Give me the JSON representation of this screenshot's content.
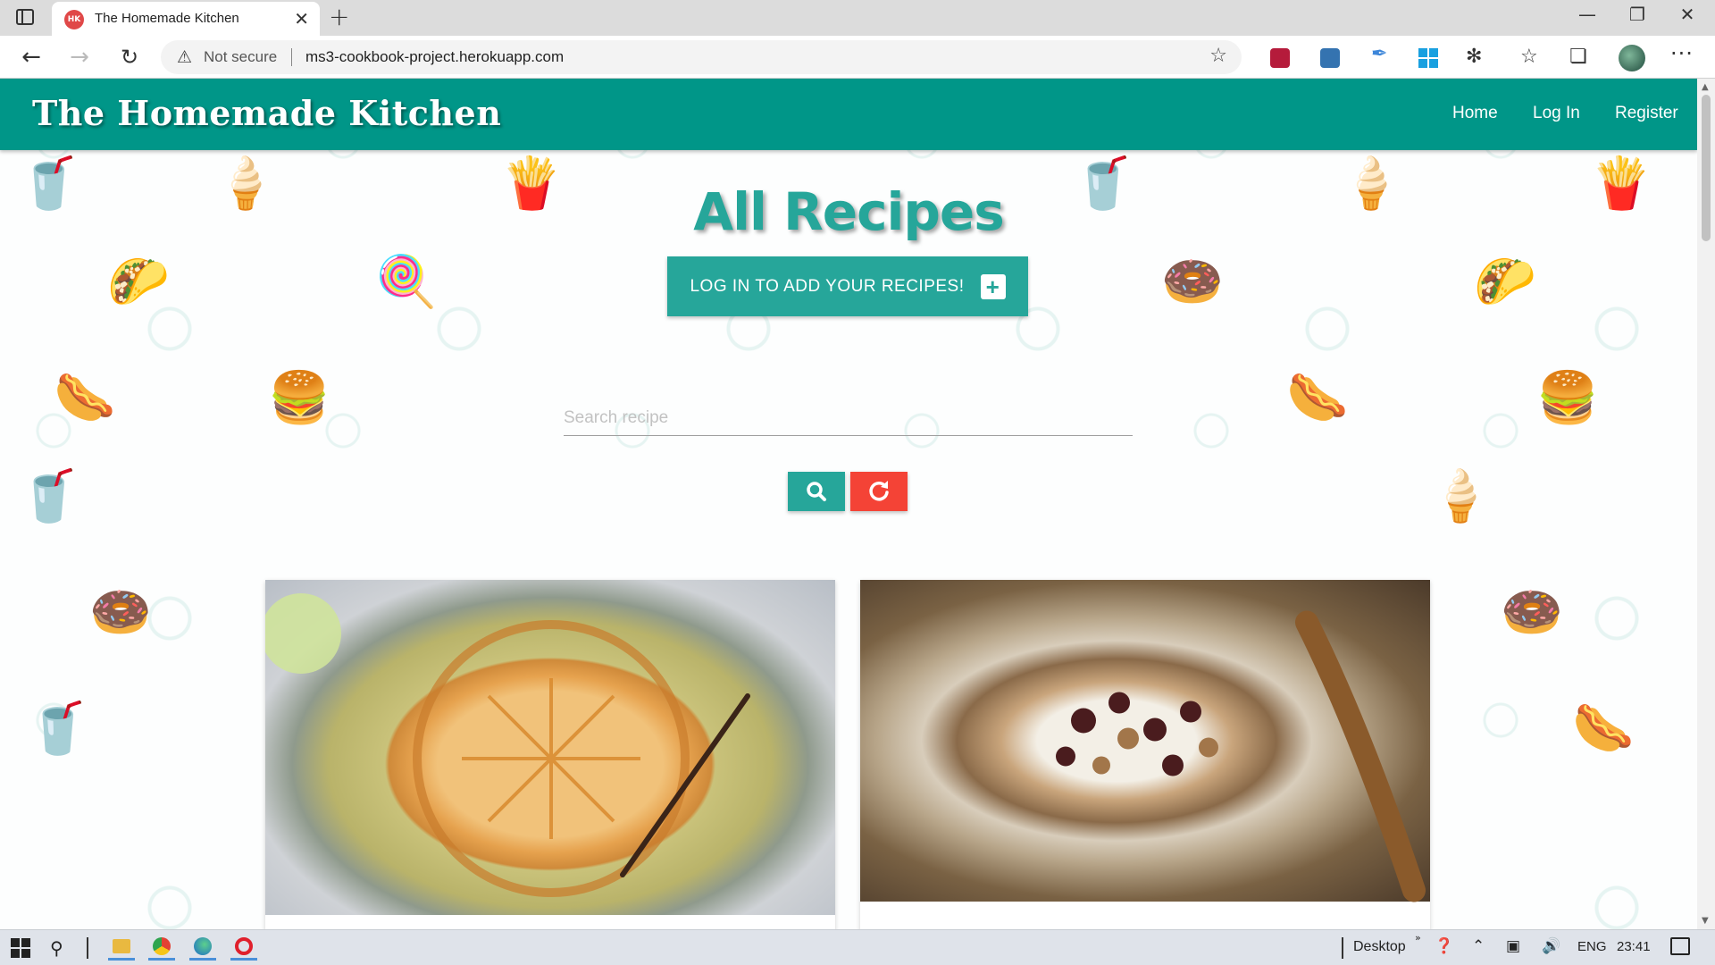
{
  "browser": {
    "tab_title": "The Homemade Kitchen",
    "favicon_text": "HK",
    "security_label": "Not secure",
    "url": "ms3-cookbook-project.herokuapp.com"
  },
  "site": {
    "brand": "The Homemade Kitchen",
    "nav": {
      "home": "Home",
      "login": "Log In",
      "register": "Register"
    }
  },
  "main": {
    "title": "All Recipes",
    "add_button_label": "LOG IN TO ADD YOUR RECIPES!",
    "search": {
      "placeholder": "Search recipe",
      "value": ""
    }
  },
  "cards": [
    {
      "image": "apple-tart-photo"
    },
    {
      "image": "granola-bowl-photo"
    }
  ],
  "colors": {
    "navbar": "#009688",
    "teal": "#26a69a",
    "red": "#f44336"
  },
  "taskbar": {
    "desktop_label": "Desktop",
    "language": "ENG",
    "time": "23:41"
  }
}
